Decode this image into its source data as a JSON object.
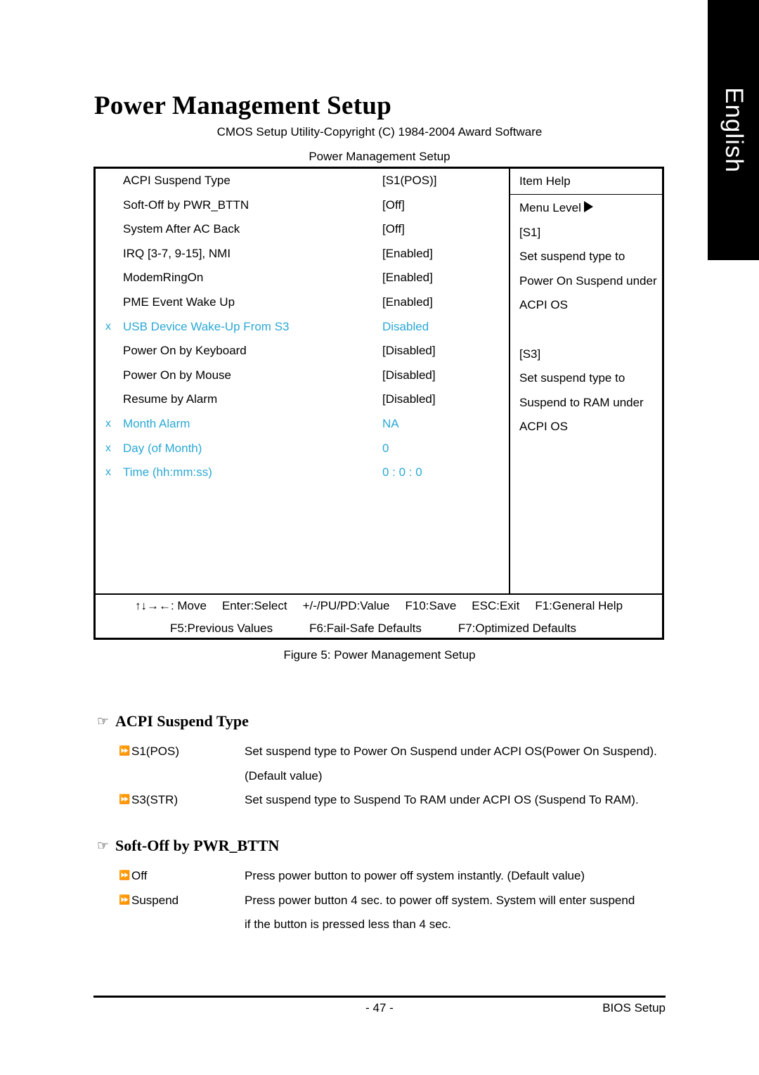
{
  "language_tab": {
    "label": "English"
  },
  "page_title": "Power Management Setup",
  "bios": {
    "copyright": "CMOS Setup Utility-Copyright (C) 1984-2004 Award Software",
    "subtitle": "Power Management Setup",
    "settings": [
      {
        "x": "",
        "label": "ACPI Suspend Type",
        "value": "[S1(POS)]",
        "disabled": false
      },
      {
        "x": "",
        "label": "Soft-Off by PWR_BTTN",
        "value": "[Off]",
        "disabled": false
      },
      {
        "x": "",
        "label": "System After AC Back",
        "value": "[Off]",
        "disabled": false
      },
      {
        "x": "",
        "label": "IRQ [3-7, 9-15], NMI",
        "value": "[Enabled]",
        "disabled": false
      },
      {
        "x": "",
        "label": "ModemRingOn",
        "value": "[Enabled]",
        "disabled": false
      },
      {
        "x": "",
        "label": "PME Event Wake Up",
        "value": "[Enabled]",
        "disabled": false
      },
      {
        "x": "x",
        "label": "USB Device Wake-Up From S3",
        "value": "Disabled",
        "disabled": true
      },
      {
        "x": "",
        "label": "Power On by Keyboard",
        "value": "[Disabled]",
        "disabled": false
      },
      {
        "x": "",
        "label": "Power On by Mouse",
        "value": "[Disabled]",
        "disabled": false
      },
      {
        "x": "",
        "label": "Resume by Alarm",
        "value": "[Disabled]",
        "disabled": false
      },
      {
        "x": "x",
        "label": "Month Alarm",
        "value": "NA",
        "disabled": true
      },
      {
        "x": "x",
        "label": "Day (of Month)",
        "value": "0",
        "disabled": true
      },
      {
        "x": "x",
        "label": "Time (hh:mm:ss)",
        "value": "0 : 0 : 0",
        "disabled": true
      }
    ],
    "help": {
      "title": "Item Help",
      "lines": [
        "Menu Level",
        "[S1]",
        "Set suspend type to",
        "Power On Suspend under",
        "ACPI OS",
        "",
        "[S3]",
        "Set suspend type to",
        "Suspend to RAM under",
        "ACPI OS"
      ]
    },
    "legend": {
      "line1": [
        "↑↓→←: Move",
        "Enter:Select",
        "+/-/PU/PD:Value",
        "F10:Save",
        "ESC:Exit",
        "F1:General Help"
      ],
      "line2": [
        "F5:Previous Values",
        "F6:Fail-Safe Defaults",
        "F7:Optimized Defaults"
      ]
    }
  },
  "figure_caption": "Figure 5: Power Management Setup",
  "sections": [
    {
      "heading": "ACPI Suspend Type",
      "options": [
        {
          "name": "S1(POS)",
          "lines": [
            "Set suspend type to Power On Suspend under ACPI OS(Power On Suspend).",
            "(Default value)"
          ]
        },
        {
          "name": "S3(STR)",
          "lines": [
            "Set suspend type to Suspend To RAM under ACPI OS (Suspend To RAM)."
          ]
        }
      ]
    },
    {
      "heading": "Soft-Off by PWR_BTTN",
      "options": [
        {
          "name": "Off",
          "lines": [
            "Press power button to power off system instantly. (Default value)"
          ]
        },
        {
          "name": "Suspend",
          "lines": [
            "Press power button 4 sec. to power off system. System will enter suspend",
            "if the button is pressed less than 4 sec."
          ]
        }
      ]
    }
  ],
  "footer": {
    "page_number": "- 47 -",
    "section_label": "BIOS Setup"
  },
  "icons": {
    "heading_bullet": "☞",
    "option_bullet": "⏩"
  },
  "colors": {
    "disabled_blue": "#2ba8d4",
    "text": "#000000",
    "tab_background": "#000000"
  }
}
